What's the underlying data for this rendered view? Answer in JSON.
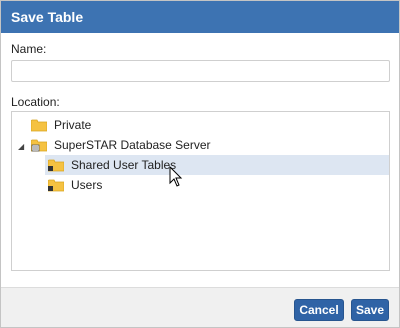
{
  "dialog": {
    "title": "Save Table",
    "name_label": "Name:",
    "name_value": "",
    "location_label": "Location:"
  },
  "tree": {
    "nodes": [
      {
        "label": "Private",
        "icon": "folder-icon"
      },
      {
        "label": "SuperSTAR Database Server",
        "icon": "server-folder-icon",
        "expanded": true
      },
      {
        "label": "Shared User Tables",
        "icon": "shared-folder-icon",
        "selected": true
      },
      {
        "label": "Users",
        "icon": "shared-folder-icon"
      }
    ]
  },
  "buttons": {
    "cancel": "Cancel",
    "save": "Save"
  },
  "colors": {
    "titlebar": "#3d73b2",
    "button": "#2f63a6",
    "selection": "#dde6f2",
    "folder": "#f5c242"
  }
}
